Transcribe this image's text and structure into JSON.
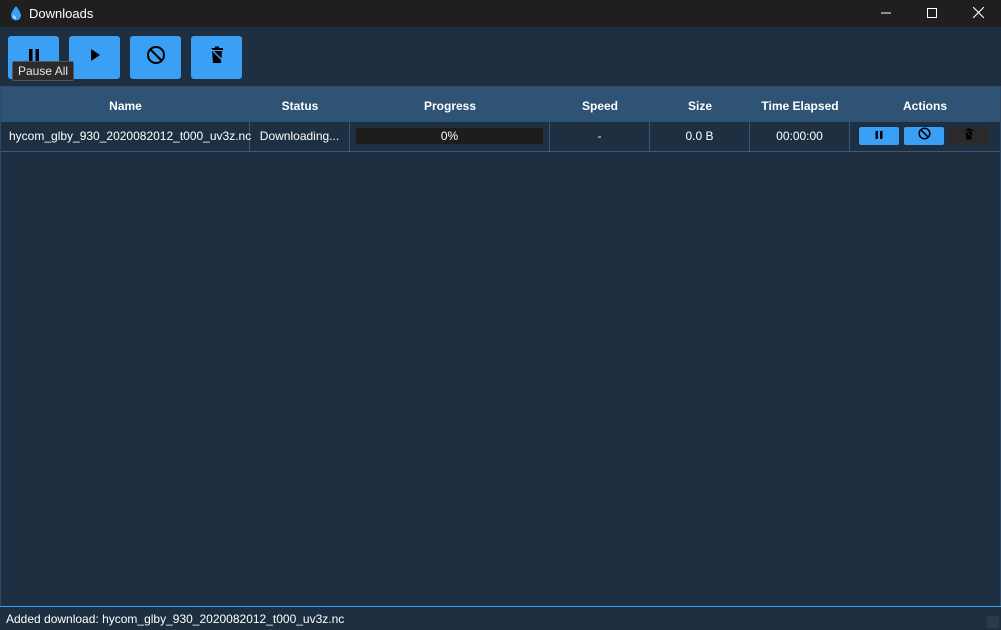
{
  "window": {
    "title": "Downloads",
    "icon": "water-drop-icon",
    "controls": [
      "minimize-icon",
      "maximize-icon",
      "close-icon"
    ]
  },
  "toolbar": {
    "buttons": [
      {
        "icon": "pause-icon",
        "tooltip": "Pause All"
      },
      {
        "icon": "play-icon"
      },
      {
        "icon": "cancel-icon"
      },
      {
        "icon": "delete-icon"
      }
    ],
    "tooltip_visible": "Pause All"
  },
  "table": {
    "columns": [
      "Name",
      "Status",
      "Progress",
      "Speed",
      "Size",
      "Time Elapsed",
      "Actions"
    ],
    "rows": [
      {
        "name": "hycom_glby_930_2020082012_t000_uv3z.nc",
        "status": "Downloading...",
        "progress_text": "0%",
        "progress": 0,
        "speed": "-",
        "size": "0.0 B",
        "time_elapsed": "00:00:00",
        "actions": [
          "pause-icon",
          "cancel-icon",
          "delete-icon"
        ]
      }
    ]
  },
  "statusbar": {
    "message": "Added download: hycom_glby_930_2020082012_t000_uv3z.nc"
  },
  "colors": {
    "accent": "#3aa0f5",
    "background": "#1e2f42",
    "header": "#2e5374",
    "titlebar": "#1f1f1f"
  }
}
